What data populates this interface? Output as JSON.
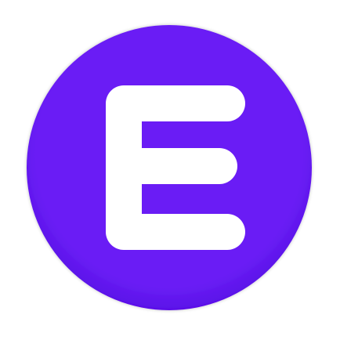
{
  "logo": {
    "name": "E",
    "letter": "E",
    "circle_color": "#6a1ff5",
    "circle_edge_color": "#5a10e8",
    "letter_color": "#ffffff"
  }
}
